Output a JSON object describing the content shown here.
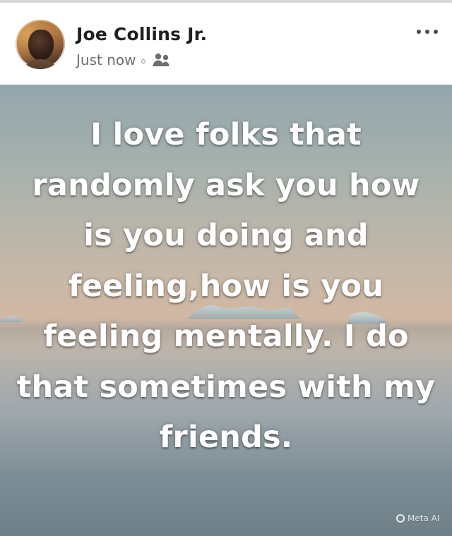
{
  "post": {
    "author": {
      "name": "Joe Collins Jr."
    },
    "meta": {
      "time": "Just now"
    },
    "image_text": "I love folks that randomly ask you how is you doing and feeling,how is you feeling mentally. I do that sometimes with my friends.",
    "badge": {
      "text": "Meta AI"
    }
  },
  "icons": {
    "more": "more-options-icon",
    "audience": "friends-audience-icon",
    "badge": "meta-ai-icon"
  },
  "colors": {
    "name": "#1f1f1f",
    "meta": "#6f6f6f",
    "quote": "#ffffff",
    "top_line": "#d9d9d9"
  }
}
